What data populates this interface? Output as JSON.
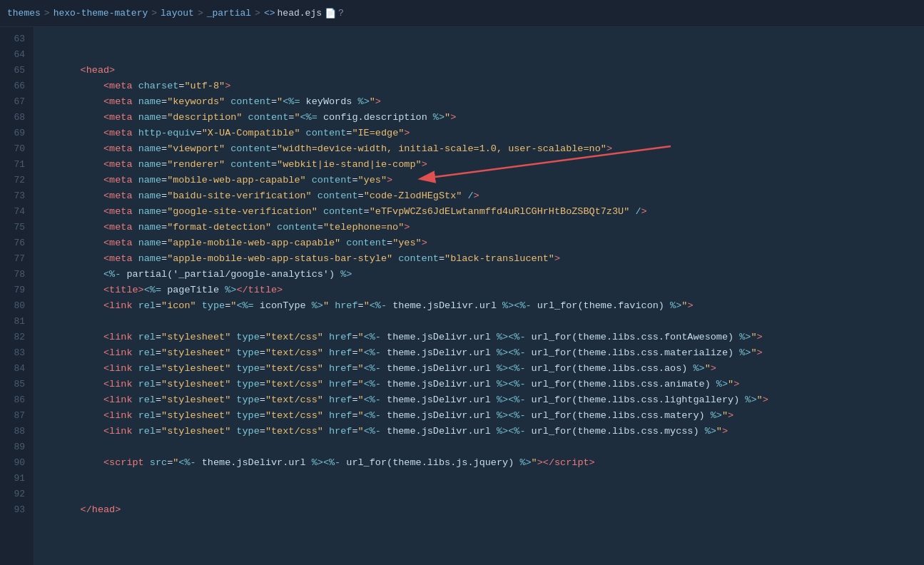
{
  "breadcrumb": {
    "items": [
      "themes",
      "hexo-theme-matery",
      "layout",
      "_partial",
      "head.ejs"
    ],
    "separators": [
      ">",
      ">",
      ">",
      ">"
    ],
    "question": "?"
  },
  "editor": {
    "bg": "#1a2332",
    "lines": [
      {
        "num": 63,
        "content": ""
      },
      {
        "num": 64,
        "content": "    <head>"
      },
      {
        "num": 65,
        "content": "        <meta charset=\"utf-8\">"
      },
      {
        "num": 66,
        "content": "        <meta name=\"keywords\" content=\"<%= keyWords %>\">"
      },
      {
        "num": 67,
        "content": "        <meta name=\"description\" content=\"<%= config.description %>\">"
      },
      {
        "num": 68,
        "content": "        <meta http-equiv=\"X-UA-Compatible\" content=\"IE=edge\">"
      },
      {
        "num": 69,
        "content": "        <meta name=\"viewport\" content=\"width=device-width, initial-scale=1.0, user-scalable=no\">"
      },
      {
        "num": 70,
        "content": "        <meta name=\"renderer\" content=\"webkit|ie-stand|ie-comp\">"
      },
      {
        "num": 71,
        "content": "        <meta name=\"mobile-web-app-capable\" content=\"yes\">"
      },
      {
        "num": 72,
        "content": "        <meta name=\"baidu-site-verification\" content=\"code-ZlodHEgStx\" />"
      },
      {
        "num": 73,
        "content": "        <meta name=\"google-site-verification\" content=\"eTFvpWCZs6JdELwtanmffd4uRlCGHrHtBoZSBQt7z3U\" />"
      },
      {
        "num": 74,
        "content": "        <meta name=\"format-detection\" content=\"telephone=no\">"
      },
      {
        "num": 75,
        "content": "        <meta name=\"apple-mobile-web-app-capable\" content=\"yes\">"
      },
      {
        "num": 76,
        "content": "        <meta name=\"apple-mobile-web-app-status-bar-style\" content=\"black-translucent\">"
      },
      {
        "num": 77,
        "content": "        <%- partial('_partial/google-analytics') %>"
      },
      {
        "num": 78,
        "content": "        <title><%= pageTitle %></title>"
      },
      {
        "num": 79,
        "content": "        <link rel=\"icon\" type=\"<%= iconType %>\" href=\"<%- theme.jsDelivr.url %><%- url_for(theme.favicon) %>\">"
      },
      {
        "num": 80,
        "content": ""
      },
      {
        "num": 81,
        "content": "        <link rel=\"stylesheet\" type=\"text/css\" href=\"<%- theme.jsDelivr.url %><%- url_for(theme.libs.css.fontAwesome) %>\">"
      },
      {
        "num": 82,
        "content": "        <link rel=\"stylesheet\" type=\"text/css\" href=\"<%- theme.jsDelivr.url %><%- url_for(theme.libs.css.materialize) %>\">"
      },
      {
        "num": 83,
        "content": "        <link rel=\"stylesheet\" type=\"text/css\" href=\"<%- theme.jsDelivr.url %><%- url_for(theme.libs.css.aos) %>\">"
      },
      {
        "num": 84,
        "content": "        <link rel=\"stylesheet\" type=\"text/css\" href=\"<%- theme.jsDelivr.url %><%- url_for(theme.libs.css.animate) %>\">"
      },
      {
        "num": 85,
        "content": "        <link rel=\"stylesheet\" type=\"text/css\" href=\"<%- theme.jsDelivr.url %><%- url_for(theme.libs.css.lightgallery) %>\">"
      },
      {
        "num": 86,
        "content": "        <link rel=\"stylesheet\" type=\"text/css\" href=\"<%- theme.jsDelivr.url %><%- url_for(theme.libs.css.matery) %>\">"
      },
      {
        "num": 87,
        "content": "        <link rel=\"stylesheet\" type=\"text/css\" href=\"<%- theme.jsDelivr.url %><%- url_for(theme.libs.css.mycss) %>\">"
      },
      {
        "num": 88,
        "content": ""
      },
      {
        "num": 89,
        "content": "        <script src=\"<%- theme.jsDelivr.url %><%- url_for(theme.libs.js.jquery) %>\"><\\/script>"
      },
      {
        "num": 90,
        "content": ""
      },
      {
        "num": 91,
        "content": ""
      },
      {
        "num": 92,
        "content": "    </head>"
      },
      {
        "num": 93,
        "content": ""
      }
    ]
  }
}
